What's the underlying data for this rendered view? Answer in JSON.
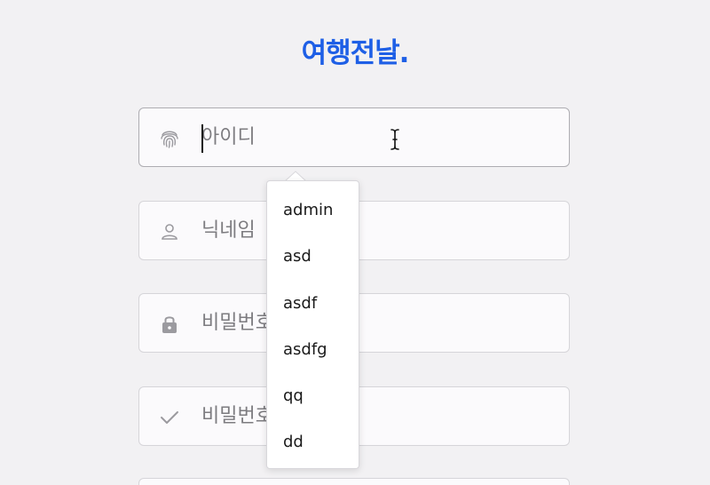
{
  "logo": {
    "text": "여행전날."
  },
  "form": {
    "id_field": {
      "placeholder": "아이디",
      "icon": "fingerprint-icon"
    },
    "nickname_field": {
      "placeholder": "닉네임",
      "icon": "person-icon"
    },
    "password_field": {
      "placeholder": "비밀번호",
      "icon": "lock-icon"
    },
    "password_confirm_field": {
      "placeholder": "비밀번호",
      "icon": "check-icon"
    }
  },
  "autocomplete": {
    "options": [
      "admin",
      "asd",
      "asdf",
      "asdfg",
      "qq",
      "dd"
    ]
  },
  "colors": {
    "brand": "#1e5fe6",
    "background": "#f2f1f3",
    "icon_gray": "#9b9a9f"
  }
}
